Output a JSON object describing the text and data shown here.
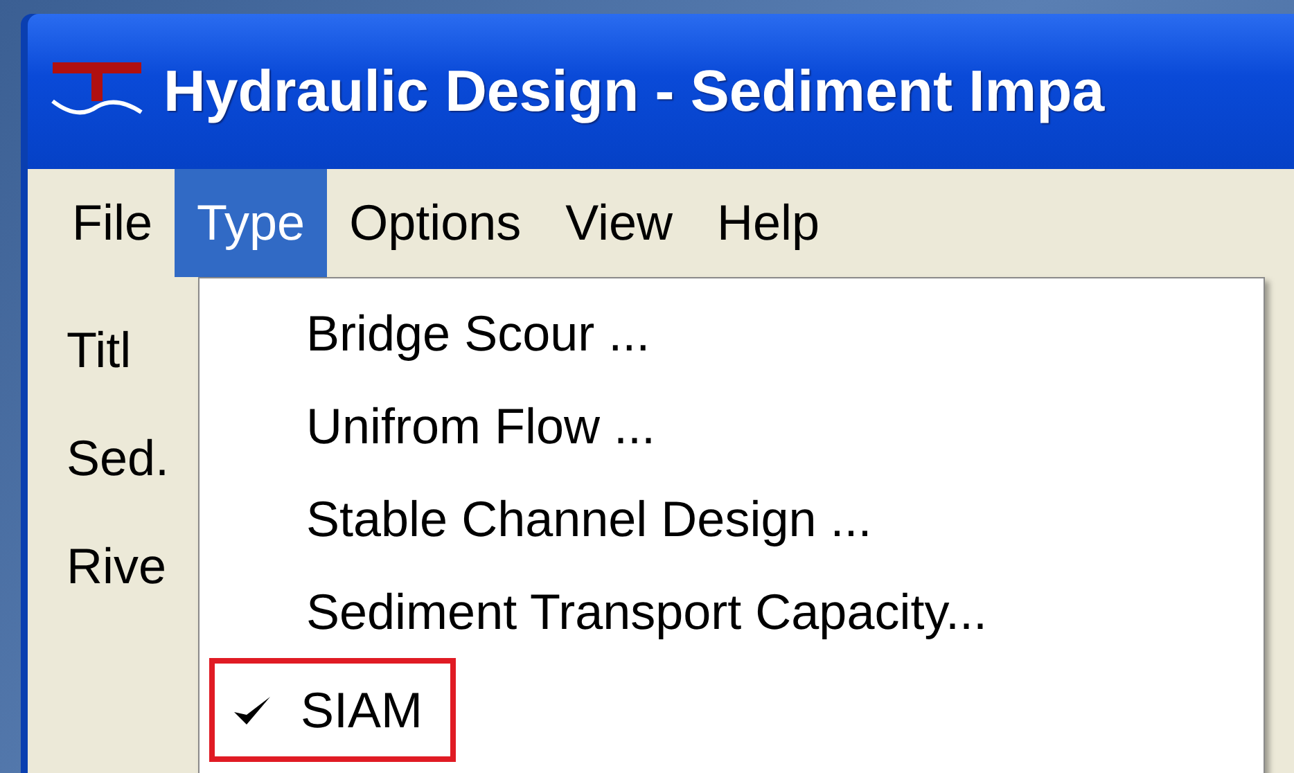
{
  "window": {
    "title": "Hydraulic Design - Sediment Impa"
  },
  "menu_bar": [
    {
      "label": "File",
      "selected": false
    },
    {
      "label": "Type",
      "selected": true
    },
    {
      "label": "Options",
      "selected": false
    },
    {
      "label": "View",
      "selected": false
    },
    {
      "label": "Help",
      "selected": false
    }
  ],
  "form_labels": [
    "Titl",
    "Sed.",
    "Rive"
  ],
  "type_menu": [
    {
      "label": "Bridge Scour ...",
      "checked": false,
      "highlighted": false
    },
    {
      "label": "Unifrom Flow ...",
      "checked": false,
      "highlighted": false
    },
    {
      "label": "Stable Channel Design ...",
      "checked": false,
      "highlighted": false
    },
    {
      "label": "Sediment Transport Capacity...",
      "checked": false,
      "highlighted": false
    },
    {
      "label": "SIAM",
      "checked": true,
      "highlighted": true
    }
  ]
}
